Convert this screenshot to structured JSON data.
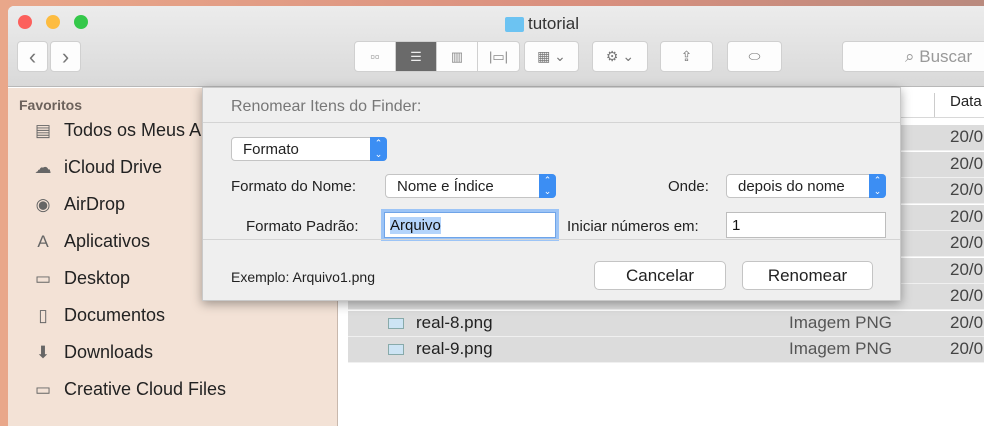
{
  "window": {
    "title": "tutorial"
  },
  "toolbar": {
    "back": "‹",
    "forward": "›",
    "views": [
      "icon",
      "list",
      "column",
      "coverflow"
    ],
    "arrange": "arrange",
    "action": "action",
    "share": "share",
    "tags": "tags",
    "search_placeholder": "Buscar"
  },
  "sidebar": {
    "heading": "Favoritos",
    "items": [
      {
        "label": "Todos os Meus Arquivos",
        "icon": "all-files-icon",
        "glyph": "▤"
      },
      {
        "label": "iCloud Drive",
        "icon": "cloud-icon",
        "glyph": "☁"
      },
      {
        "label": "AirDrop",
        "icon": "airdrop-icon",
        "glyph": "◉"
      },
      {
        "label": "Aplicativos",
        "icon": "applications-icon",
        "glyph": "A"
      },
      {
        "label": "Desktop",
        "icon": "desktop-icon",
        "glyph": "▭"
      },
      {
        "label": "Documentos",
        "icon": "documents-icon",
        "glyph": "▯"
      },
      {
        "label": "Downloads",
        "icon": "downloads-icon",
        "glyph": "⬇"
      },
      {
        "label": "Creative Cloud Files",
        "icon": "folder-icon",
        "glyph": "▭"
      }
    ]
  },
  "list": {
    "date_header": "Data",
    "rows": [
      {
        "name": "",
        "kind": "",
        "date": "20/0"
      },
      {
        "name": "",
        "kind": "",
        "date": "20/0"
      },
      {
        "name": "",
        "kind": "",
        "date": "20/0"
      },
      {
        "name": "",
        "kind": "",
        "date": "20/0"
      },
      {
        "name": "",
        "kind": "",
        "date": "20/0"
      },
      {
        "name": "",
        "kind": "",
        "date": "20/0"
      },
      {
        "name": "",
        "kind": "",
        "date": "20/0"
      },
      {
        "name": "real-8.png",
        "kind": "Imagem PNG",
        "date": "20/0"
      },
      {
        "name": "real-9.png",
        "kind": "Imagem PNG",
        "date": "20/0"
      }
    ]
  },
  "sheet": {
    "title": "Renomear Itens do Finder:",
    "mode": "Formato",
    "name_format_label": "Formato do Nome:",
    "name_format": "Nome e Índice",
    "where_label": "Onde:",
    "where": "depois do nome",
    "custom_format_label": "Formato Padrão:",
    "custom_format": "Arquivo",
    "start_label": "Iniciar números em:",
    "start": "1",
    "example": "Exemplo: Arquivo1.png",
    "cancel": "Cancelar",
    "rename": "Renomear"
  },
  "colors": {
    "accent": "#3c8ef3",
    "selection": "#dcdcdc"
  }
}
